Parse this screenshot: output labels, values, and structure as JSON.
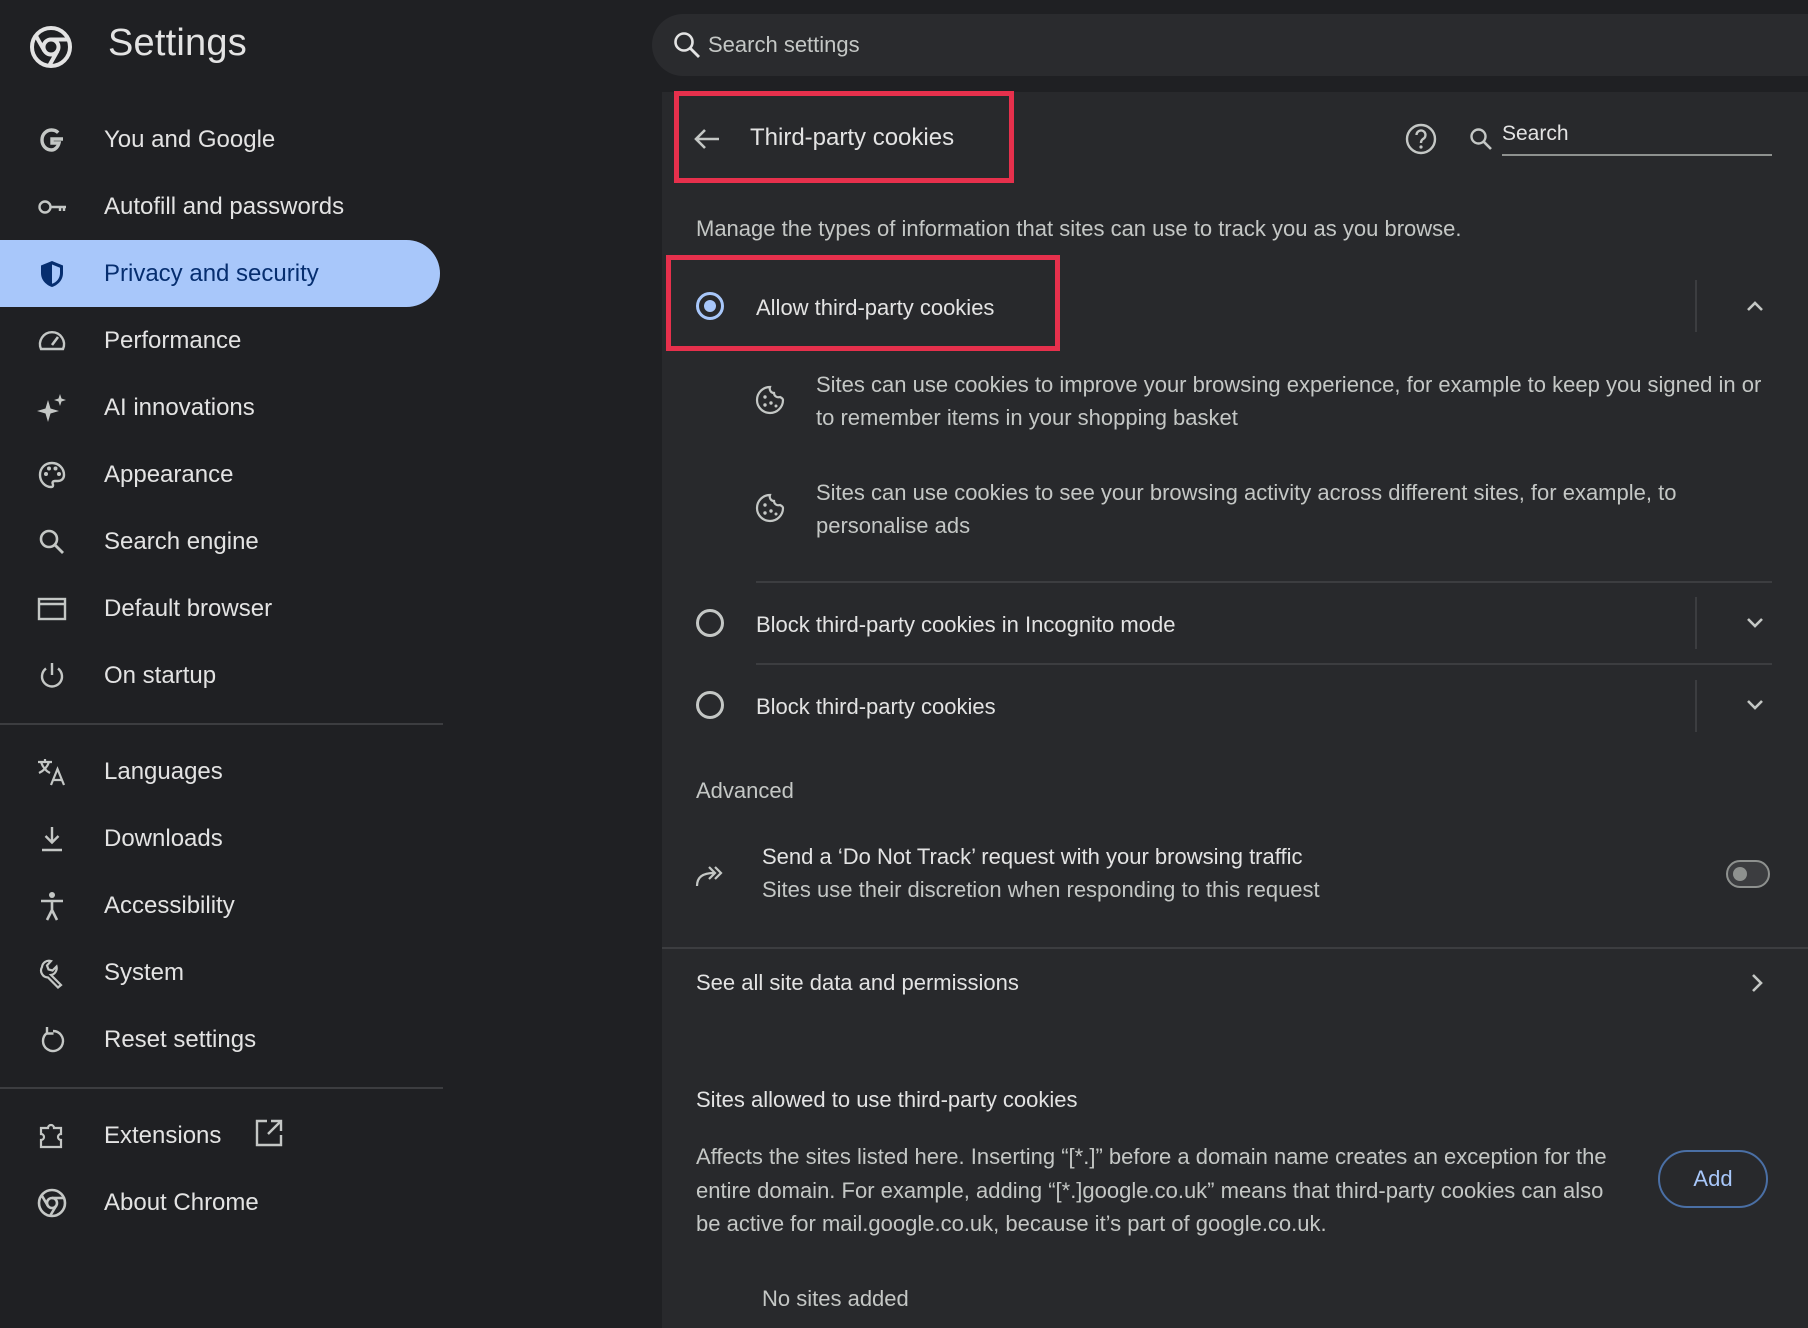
{
  "app": {
    "title": "Settings",
    "search_placeholder": "Search settings"
  },
  "sidebar": {
    "items": [
      {
        "label": "You and Google",
        "icon": "google-g-icon"
      },
      {
        "label": "Autofill and passwords",
        "icon": "key-icon"
      },
      {
        "label": "Privacy and security",
        "icon": "shield-icon",
        "active": true
      },
      {
        "label": "Performance",
        "icon": "speedometer-icon"
      },
      {
        "label": "AI innovations",
        "icon": "sparkle-icon"
      },
      {
        "label": "Appearance",
        "icon": "palette-icon"
      },
      {
        "label": "Search engine",
        "icon": "search-icon"
      },
      {
        "label": "Default browser",
        "icon": "browser-window-icon"
      },
      {
        "label": "On startup",
        "icon": "power-icon"
      }
    ],
    "items2": [
      {
        "label": "Languages",
        "icon": "translate-icon"
      },
      {
        "label": "Downloads",
        "icon": "download-icon"
      },
      {
        "label": "Accessibility",
        "icon": "accessibility-icon"
      },
      {
        "label": "System",
        "icon": "wrench-icon"
      },
      {
        "label": "Reset settings",
        "icon": "reset-icon"
      }
    ],
    "items3": [
      {
        "label": "Extensions",
        "icon": "puzzle-icon"
      },
      {
        "label": "About Chrome",
        "icon": "chrome-logo-icon"
      }
    ]
  },
  "panel": {
    "title": "Third-party cookies",
    "search_placeholder": "Search",
    "description": "Manage the types of information that sites can use to track you as you browse.",
    "options": [
      {
        "label": "Allow third-party cookies",
        "selected": true,
        "expanded": true
      },
      {
        "label": "Block third-party cookies in Incognito mode",
        "selected": false,
        "expanded": false
      },
      {
        "label": "Block third-party cookies",
        "selected": false,
        "expanded": false
      }
    ],
    "allow_details": [
      "Sites can use cookies to improve your browsing experience, for example to keep you signed in or to remember items in your shopping basket",
      "Sites can use cookies to see your browsing activity across different sites, for example, to personalise ads"
    ],
    "advanced": {
      "heading": "Advanced",
      "dnt_title": "Send a ‘Do Not Track’ request with your browsing traffic",
      "dnt_subtitle": "Sites use their discretion when responding to this request",
      "dnt_enabled": false
    },
    "site_data_link": "See all site data and permissions",
    "allowed_sites": {
      "heading": "Sites allowed to use third-party cookies",
      "description": "Affects the sites listed here. Inserting “[*.]” before a domain name creates an exception for the entire domain. For example, adding “[*.]google.co.uk” means that third-party cookies can also be active for mail.google.co.uk, because it’s part of google.co.uk.",
      "add_label": "Add",
      "empty_label": "No sites added"
    }
  },
  "colors": {
    "accent": "#a8c7fa",
    "highlight": "#e6304c",
    "background": "#1f2023",
    "panel": "#28292c"
  }
}
